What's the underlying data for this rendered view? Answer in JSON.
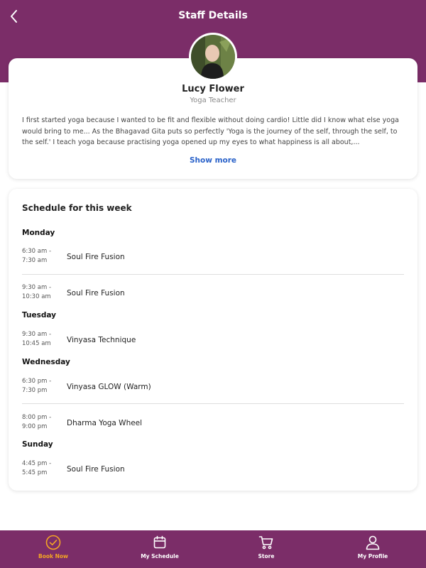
{
  "header": {
    "title": "Staff Details"
  },
  "profile": {
    "name": "Lucy Flower",
    "role": "Yoga Teacher",
    "bio": "I first started yoga because I wanted to be fit and flexible without doing cardio! Little did I know what else yoga would bring to me...  As the Bhagavad Gita puts so perfectly 'Yoga is the journey of the self, through the self, to the self.'   I teach yoga because practising yoga opened up my eyes to what happiness is all about,...",
    "show_more": "Show more"
  },
  "schedule": {
    "title": "Schedule for this week",
    "days": [
      {
        "day": "Monday",
        "slots": [
          {
            "time": "6:30 am -\n7:30 am",
            "class": "Soul Fire Fusion"
          },
          {
            "time": "9:30 am -\n10:30 am",
            "class": "Soul Fire Fusion"
          }
        ]
      },
      {
        "day": "Tuesday",
        "slots": [
          {
            "time": "9:30 am -\n10:45 am",
            "class": "Vinyasa Technique"
          }
        ]
      },
      {
        "day": "Wednesday",
        "slots": [
          {
            "time": "6:30 pm -\n7:30 pm",
            "class": "Vinyasa GLOW (Warm)"
          },
          {
            "time": "8:00 pm -\n9:00 pm",
            "class": "Dharma Yoga Wheel"
          }
        ]
      },
      {
        "day": "Sunday",
        "slots": [
          {
            "time": "4:45 pm -\n5:45 pm",
            "class": "Soul Fire Fusion"
          }
        ]
      }
    ]
  },
  "tabbar": {
    "items": [
      {
        "label": "Book Now",
        "icon": "check-circle-icon",
        "active": true
      },
      {
        "label": "My Schedule",
        "icon": "calendar-icon",
        "active": false
      },
      {
        "label": "Store",
        "icon": "cart-icon",
        "active": false
      },
      {
        "label": "My Profile",
        "icon": "user-icon",
        "active": false
      }
    ]
  },
  "colors": {
    "brand": "#7b2d68",
    "active_tab": "#f5a623",
    "link": "#2a62c9"
  }
}
